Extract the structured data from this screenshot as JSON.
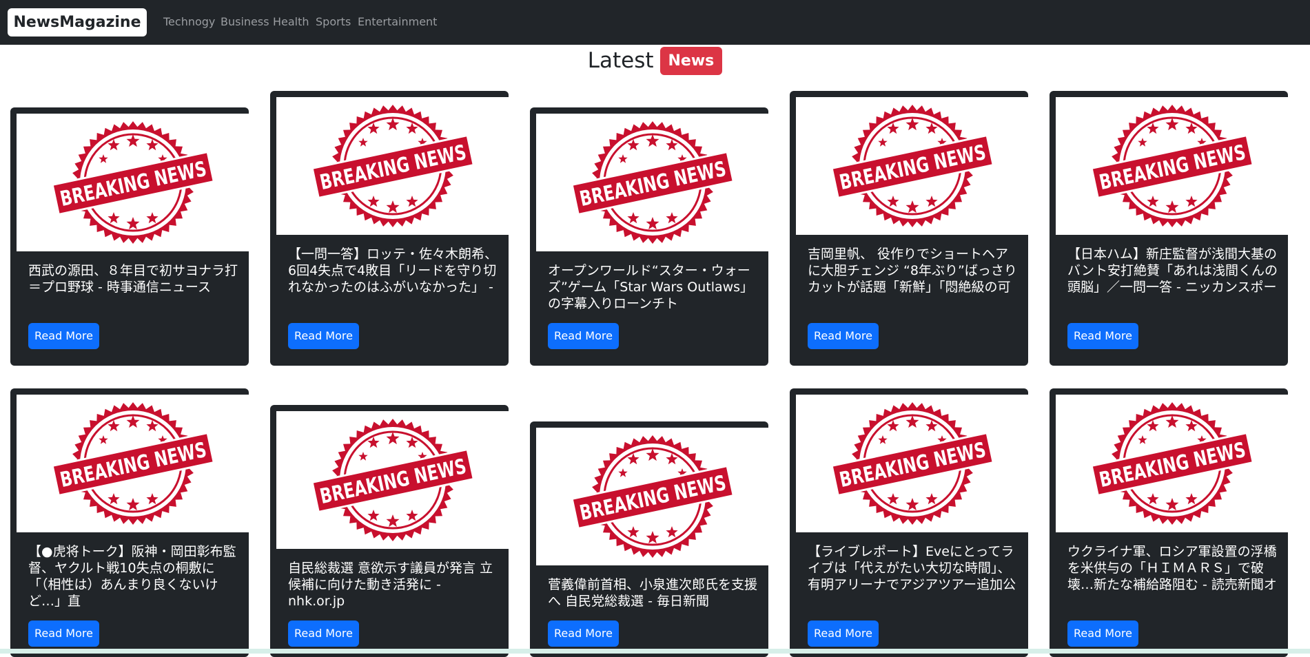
{
  "nav": {
    "brand": "NewsMagazine",
    "links": [
      "Technogy",
      "Business",
      "Health",
      "Sports",
      "Entertainment"
    ]
  },
  "heading": {
    "text": "Latest",
    "badge": "News"
  },
  "image": {
    "line1": "BREAKING",
    "line2": "NEWS",
    "color": "#c8102e"
  },
  "cards": [
    {
      "title": "西武の源田、８年目で初サヨナラ打＝プロ野球 - 時事通信ニュース",
      "button": "Read More"
    },
    {
      "title": "【一問一答】ロッテ・佐々木朗希、6回4失点で4敗目「リードを守り切れなかったのはふがいなかった」 -",
      "button": "Read More"
    },
    {
      "title": "オープンワールド“スター・ウォーズ”ゲーム「Star Wars Outlaws」の字幕入りローンチト",
      "button": "Read More"
    },
    {
      "title": "吉岡里帆、 役作りでショートヘアに大胆チェンジ “8年ぶり”ばっさりカットが話題「新鮮」「悶絶級の可",
      "button": "Read More"
    },
    {
      "title": "【日本ハム】新庄監督が浅間大基のバント安打絶賛「あれは浅間くんの頭脳」／一問一答 - ニッカンスポー",
      "button": "Read More"
    },
    {
      "title": "【●虎将トーク】阪神・岡田彰布監督、ヤクルト戦10失点の桐敷に「（相性は）あんまり良くないけど…」直",
      "button": "Read More"
    },
    {
      "title": "自民総裁選 意欲示す議員が発言 立候補に向けた動き活発に - nhk.or.jp",
      "button": "Read More"
    },
    {
      "title": "菅義偉前首相、小泉進次郎氏を支援へ 自民党総裁選 - 毎日新聞",
      "button": "Read More"
    },
    {
      "title": "【ライブレポート】Eveにとってライブは「代えがたい大切な時間」、有明アリーナでアジアツアー追加公演",
      "button": "Read More"
    },
    {
      "title": "ウクライナ軍、ロシア軍設置の浮橋を米供与の「ＨＩＭＡＲＳ」で破壊…新たな補給路阻む - 読売新聞オン",
      "button": "Read More"
    }
  ]
}
